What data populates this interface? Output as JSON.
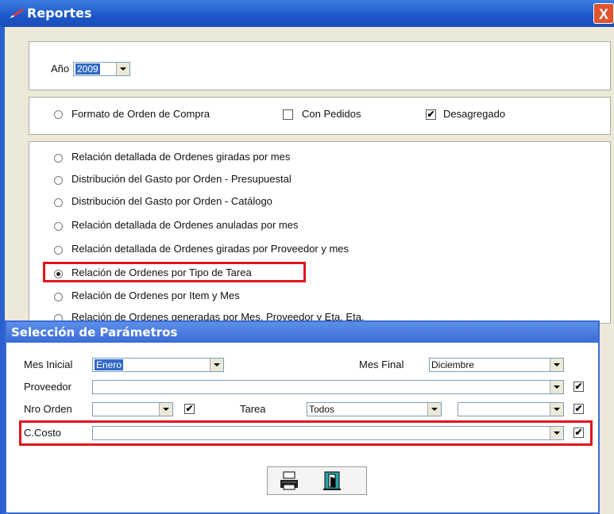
{
  "window": {
    "title": "Reportes",
    "close": "X"
  },
  "year": {
    "label": "Año",
    "value": "2009"
  },
  "format": {
    "radio_label": "Formato de Orden de Compra",
    "con_pedidos": {
      "label": "Con Pedidos",
      "checked": false
    },
    "desagregado": {
      "label": "Desagregado",
      "checked": true
    }
  },
  "reports": [
    {
      "label": "Relación detallada de Ordenes giradas por mes",
      "selected": false
    },
    {
      "label": "Distribución del Gasto por Orden - Presupuestal",
      "selected": false
    },
    {
      "label": "Distribución del Gasto por Orden - Catálogo",
      "selected": false
    },
    {
      "label": "Relación detallada de Ordenes anuladas por mes",
      "selected": false
    },
    {
      "label": "Relación detallada de Ordenes giradas por Proveedor y mes",
      "selected": false
    },
    {
      "label": "Relación de Ordenes por Tipo de Tarea",
      "selected": true
    },
    {
      "label": "Relación de Ordenes por Item y Mes",
      "selected": false
    },
    {
      "label": "Relación de Ordenes generadas por Mes, Proveedor y Eta. Eta.",
      "selected": false
    }
  ],
  "params": {
    "title": "Selección de Parámetros",
    "mes_inicial": {
      "label": "Mes Inicial",
      "value": "Enero"
    },
    "mes_final": {
      "label": "Mes Final",
      "value": "Diciembre"
    },
    "proveedor": {
      "label": "Proveedor",
      "value": ""
    },
    "nro_orden": {
      "label": "Nro Orden",
      "value": ""
    },
    "tarea": {
      "label": "Tarea",
      "value": "Todos"
    },
    "ccosto": {
      "label": "C.Costo",
      "value": ""
    },
    "check_mark": "✔"
  },
  "icons": {
    "print": "printer-icon",
    "exit": "exit-door-icon"
  }
}
